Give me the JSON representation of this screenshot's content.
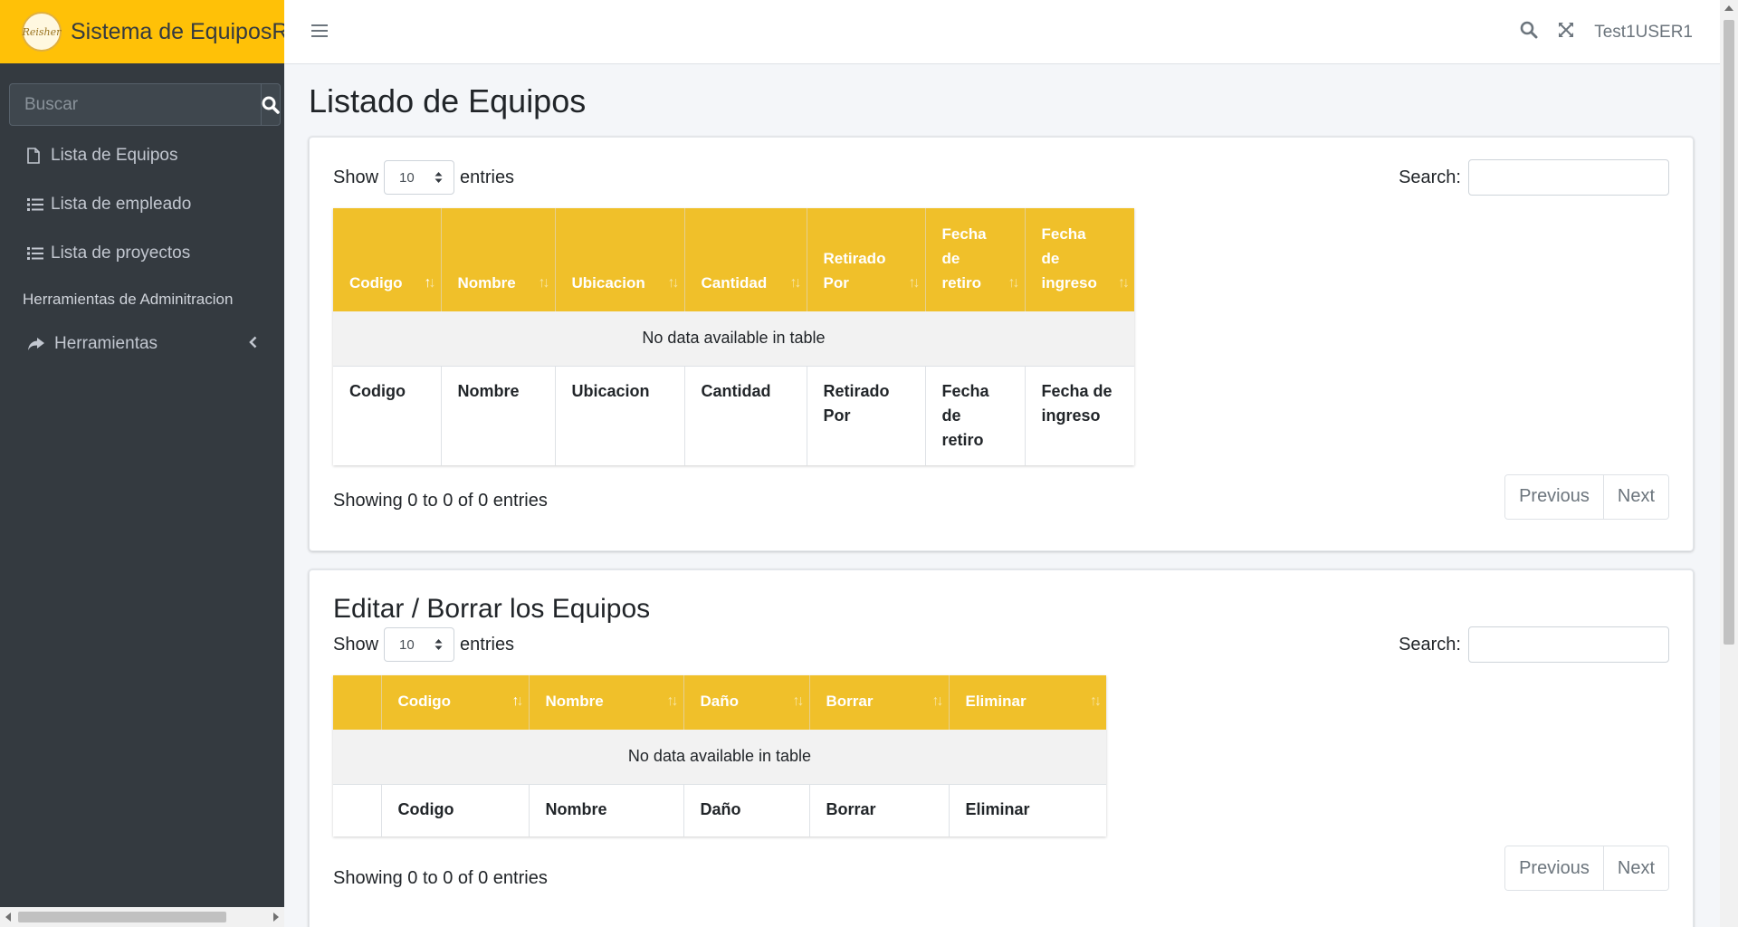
{
  "brand": {
    "logo_text": "Reisher",
    "name": "Sistema de EquiposRe"
  },
  "sidebar": {
    "search_placeholder": "Buscar",
    "items": [
      {
        "label": "Lista de Equipos",
        "icon": "file-icon"
      },
      {
        "label": "Lista de empleado",
        "icon": "list-icon"
      },
      {
        "label": "Lista de proyectos",
        "icon": "list-icon"
      }
    ],
    "header": "Herramientas de Adminitracion",
    "tools": {
      "label": "Herramientas",
      "icon": "share-icon"
    }
  },
  "topbar": {
    "user": "Test1USER1"
  },
  "page_title": "Listado de Equipos",
  "table1": {
    "show_label": "Show",
    "length_value": "10",
    "entries_label": "entries",
    "search_label": "Search:",
    "headers": [
      "Codigo",
      "Nombre",
      "Ubicacion",
      "Cantidad",
      "Retirado Por",
      "Fecha de retiro",
      "Fecha de ingreso"
    ],
    "empty": "No data available in table",
    "footers": [
      "Codigo",
      "Nombre",
      "Ubicacion",
      "Cantidad",
      "Retirado Por",
      "Fecha de retiro",
      "Fecha de ingreso"
    ],
    "info": "Showing 0 to 0 of 0 entries",
    "prev": "Previous",
    "next": "Next"
  },
  "card2_title": "Editar / Borrar los Equipos",
  "table2": {
    "show_label": "Show",
    "length_value": "10",
    "entries_label": "entries",
    "search_label": "Search:",
    "headers": [
      "",
      "Codigo",
      "Nombre",
      "Daño",
      "Borrar",
      "Eliminar"
    ],
    "empty": "No data available in table",
    "footers": [
      "",
      "Codigo",
      "Nombre",
      "Daño",
      "Borrar",
      "Eliminar"
    ],
    "info": "Showing 0 to 0 of 0 entries",
    "prev": "Previous",
    "next": "Next"
  },
  "colors": {
    "brand": "#ffc107",
    "sidebar": "#343a40",
    "table_header": "#f0c02a"
  }
}
